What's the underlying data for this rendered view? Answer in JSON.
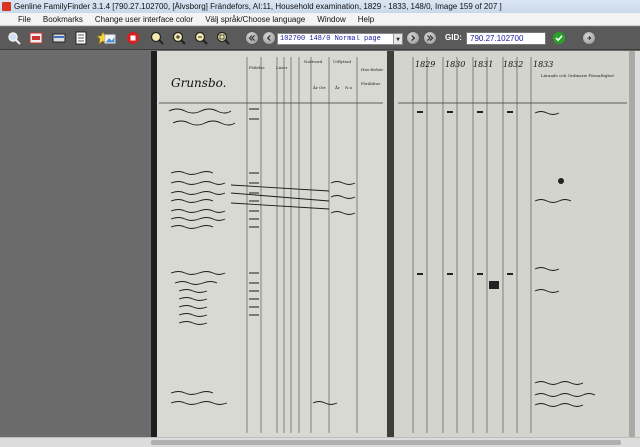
{
  "window": {
    "title": "Genline FamilyFinder 3.1.4    [790.27.102700,  [Älvsborg]  Frändefors,  AI:11, Household examination, 1829  - 1833, 148/0, Image 159 of 207  ]"
  },
  "menu": [
    "File",
    "Bookmarks",
    "Change user interface color",
    "Välj språk/Choose language",
    "Window",
    "Help"
  ],
  "toolbar": {
    "icons": [
      "search-icon",
      "print-icon",
      "scanner-icon",
      "notes-icon",
      "highlight-icon",
      "image-icon",
      "stop-icon",
      "zoom-fit-icon",
      "zoom-in-icon",
      "zoom-out-icon",
      "zoom-actual-icon",
      "first-page-icon",
      "previous-page-icon",
      "next-page-icon",
      "last-page-icon",
      "confirm-icon",
      "exit-icon"
    ],
    "image_select": "102700    148/0    Normal page",
    "gid_label": "GID:",
    "gid_value": "790.27.102700"
  },
  "colors": {
    "title_bar": "#c9d8ec",
    "toolbar": "#5a5a5a",
    "workspace": "#6b6b6b",
    "confirm_green": "#2aa12a",
    "stop_red": "#d71f1f"
  },
  "document": {
    "left_page_heading": "Grunsbo.",
    "left_column_headers": [
      "Födelse",
      "Läser",
      "Nattvard",
      "Utflyttad",
      "Hus-förhör",
      "År",
      "Ort",
      "År",
      "N:o",
      "Föräldrar"
    ],
    "right_column_years": [
      "1829",
      "1830",
      "1831",
      "1832",
      "1833"
    ],
    "right_column_header": "Lärande och Ordinarie Förnuftighet"
  }
}
